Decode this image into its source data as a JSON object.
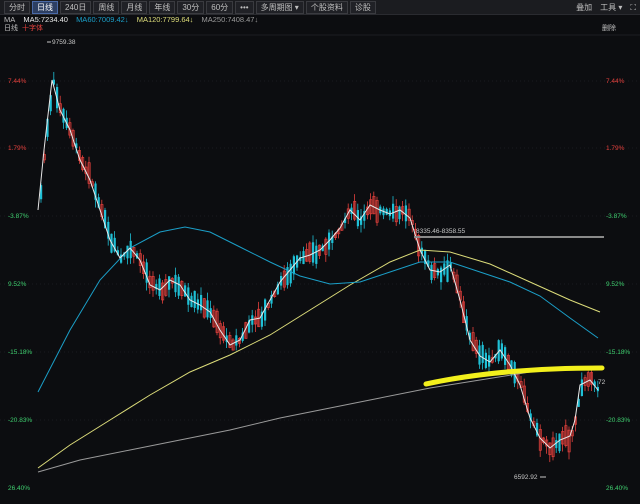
{
  "toolbar": {
    "tabs": [
      {
        "label": "分时",
        "active": false
      },
      {
        "label": "日线",
        "active": true
      },
      {
        "label": "240日",
        "active": false
      },
      {
        "label": "周线",
        "active": false
      },
      {
        "label": "月线",
        "active": false
      },
      {
        "label": "年线",
        "active": false
      },
      {
        "label": "30分",
        "active": false
      },
      {
        "label": "60分",
        "active": false
      },
      {
        "label": "•••",
        "active": false
      },
      {
        "label": "多周期图 ▾",
        "active": false
      },
      {
        "label": "个股资料",
        "active": false
      },
      {
        "label": "诊股",
        "active": false
      }
    ],
    "right": {
      "compare": "叠加",
      "tools": "工具 ▾"
    }
  },
  "ma_bar": {
    "label": "MA",
    "ma5": "MA5:7234.40",
    "ma60": "MA60:7009.42↓",
    "ma120": "MA120:7799.64↓",
    "ma250": "MA250:7408.47↓"
  },
  "subbar": {
    "left": "日线",
    "center": "十字体",
    "right": "删除"
  },
  "colors": {
    "up": "#e5413d",
    "down": "#1fc0d6",
    "ma5": "#e8e8e8",
    "ma60": "#1b9fc8",
    "ma120": "#dcdc7a",
    "ma250": "#9a9a9a",
    "highlight": "#f3f01c"
  },
  "y_labels": [
    "7.44%",
    "1.79%",
    "-3.87%",
    "9.52%",
    "-15.18%",
    "-20.83%",
    "26.40%"
  ],
  "annotations": {
    "high": "9759.38",
    "band": "8335.46-8358.55",
    "low": "6592.92",
    "last": "72"
  }
}
